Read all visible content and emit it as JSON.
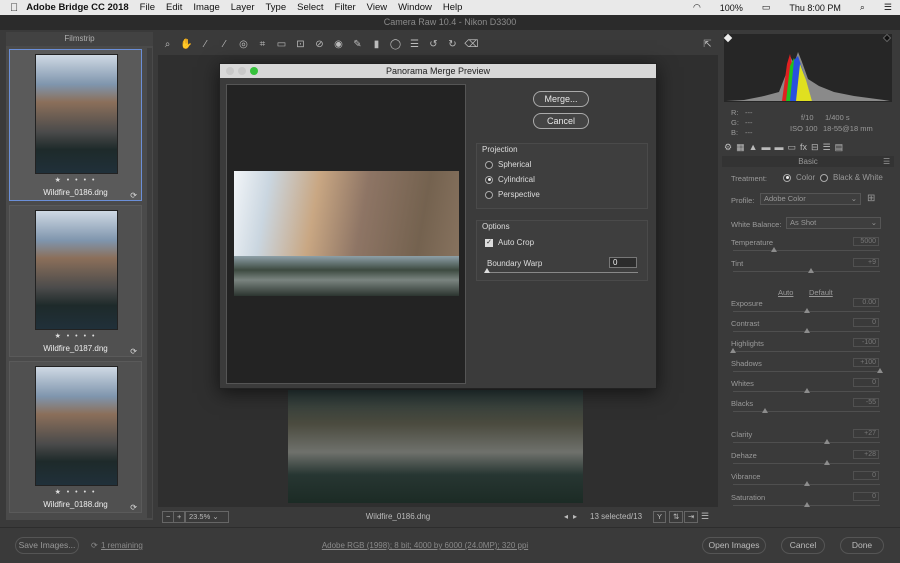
{
  "menubar": {
    "app": "Adobe Bridge CC 2018",
    "items": [
      "File",
      "Edit",
      "Image",
      "Layer",
      "Type",
      "Select",
      "Filter",
      "View",
      "Window",
      "Help"
    ],
    "battery": "100%",
    "clock": "Thu 8:00 PM"
  },
  "window": {
    "title": "Camera Raw 10.4  -  Nikon D3300"
  },
  "filmstrip": {
    "title": "Filmstrip",
    "thumbs": [
      {
        "name": "Wildfire_0186.dng",
        "stars": "★ • • • •"
      },
      {
        "name": "Wildfire_0187.dng",
        "stars": "★ • • • •"
      },
      {
        "name": "Wildfire_0188.dng",
        "stars": "★ • • • •"
      }
    ]
  },
  "dialog": {
    "title": "Panorama Merge Preview",
    "merge_label": "Merge...",
    "cancel_label": "Cancel",
    "projection": {
      "title": "Projection",
      "options": [
        "Spherical",
        "Cylindrical",
        "Perspective"
      ],
      "selected": "Cylindrical"
    },
    "options": {
      "title": "Options",
      "auto_crop": "Auto Crop",
      "boundary_warp_label": "Boundary Warp",
      "boundary_warp_value": "0"
    }
  },
  "bottombar": {
    "zoom": "23.5%",
    "filename": "Wildfire_0186.dng",
    "selection": "13 selected/13"
  },
  "histogram": {
    "rgb": [
      "R:",
      "G:",
      "B:"
    ],
    "dashes": "---",
    "aperture": "f/10",
    "shutter": "1/400 s",
    "iso": "ISO 100",
    "lens": "18-55@18 mm"
  },
  "basic": {
    "title": "Basic",
    "treatment_label": "Treatment:",
    "treatment_color": "Color",
    "treatment_bw": "Black & White",
    "profile_label": "Profile:",
    "profile_value": "Adobe Color",
    "wb_label": "White Balance:",
    "wb_value": "As Shot",
    "auto": "Auto",
    "default": "Default",
    "sliders": [
      {
        "label": "Temperature",
        "value": "5000",
        "pos": 0.28
      },
      {
        "label": "Tint",
        "value": "+9",
        "pos": 0.53
      },
      {
        "label": "Exposure",
        "value": "0.00",
        "pos": 0.5
      },
      {
        "label": "Contrast",
        "value": "0",
        "pos": 0.5
      },
      {
        "label": "Highlights",
        "value": "-100",
        "pos": 0.0
      },
      {
        "label": "Shadows",
        "value": "+100",
        "pos": 1.0
      },
      {
        "label": "Whites",
        "value": "0",
        "pos": 0.5
      },
      {
        "label": "Blacks",
        "value": "-55",
        "pos": 0.22
      },
      {
        "label": "Clarity",
        "value": "+27",
        "pos": 0.64
      },
      {
        "label": "Dehaze",
        "value": "+28",
        "pos": 0.64
      },
      {
        "label": "Vibrance",
        "value": "0",
        "pos": 0.5
      },
      {
        "label": "Saturation",
        "value": "0",
        "pos": 0.5
      }
    ]
  },
  "footer": {
    "save": "Save Images...",
    "remaining": "1 remaining",
    "info": "Adobe RGB (1998); 8 bit; 4000 by 6000 (24.0MP); 320 ppi",
    "open": "Open Images",
    "cancel": "Cancel",
    "done": "Done"
  }
}
